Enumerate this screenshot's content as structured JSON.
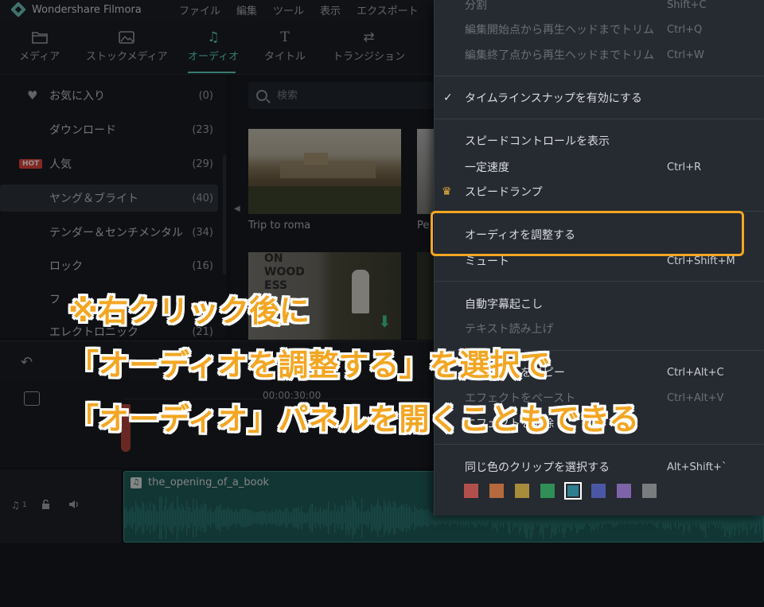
{
  "app": {
    "name": "Wondershare Filmora"
  },
  "menubar": [
    "ファイル",
    "編集",
    "ツール",
    "表示",
    "エクスポート"
  ],
  "tabs": [
    {
      "label": "メディア",
      "icon": "folder-icon"
    },
    {
      "label": "ストックメディア",
      "icon": "image-icon"
    },
    {
      "label": "オーディオ",
      "icon": "music-note-icon",
      "active": true
    },
    {
      "label": "タイトル",
      "icon": "text-icon"
    },
    {
      "label": "トランジション",
      "icon": "transition-icon"
    }
  ],
  "sidebar": {
    "items": [
      {
        "label": "お気に入り",
        "count": "(0)",
        "icon": "heart-icon"
      },
      {
        "label": "ダウンロード",
        "count": "(23)"
      },
      {
        "label": "人気",
        "count": "(29)",
        "badge": "HOT"
      },
      {
        "label": "ヤング＆ブライト",
        "count": "(40)",
        "selected": true
      },
      {
        "label": "テンダー＆センチメンタル",
        "count": "(34)"
      },
      {
        "label": "ロック",
        "count": "(16)"
      },
      {
        "label": "フ",
        "count": ""
      },
      {
        "label": "エレクトロニック",
        "count": "(21)"
      }
    ]
  },
  "search": {
    "placeholder": "検索"
  },
  "media": {
    "items": [
      {
        "caption": "Trip to roma"
      },
      {
        "caption": "Pe"
      }
    ],
    "thumb_text": [
      "ON",
      "WOOD",
      "ESS"
    ]
  },
  "timeline": {
    "time_marker": "00:00:30:00",
    "clip_name": "the_opening_of_a_book",
    "track_number": "1"
  },
  "context_menu": {
    "items": [
      {
        "label": "分割",
        "shortcut": "Shift+C",
        "disabled": true
      },
      {
        "label": "編集開始点から再生ヘッドまでトリム",
        "shortcut": "Ctrl+Q",
        "disabled": true
      },
      {
        "label": "編集終了点から再生ヘッドまでトリム",
        "shortcut": "Ctrl+W",
        "disabled": true
      },
      {
        "label": "タイムラインスナップを有効にする",
        "shortcut": "",
        "checked": true
      },
      {
        "label": "スピードコントロールを表示",
        "shortcut": ""
      },
      {
        "label": "一定速度",
        "shortcut": "Ctrl+R"
      },
      {
        "label": "スピードランプ",
        "shortcut": "",
        "icon": "crown-icon"
      },
      {
        "label": "オーディオを調整する",
        "shortcut": "",
        "highlighted": true
      },
      {
        "label": "ミュート",
        "shortcut": "Ctrl+Shift+M"
      },
      {
        "label": "自動字幕起こし",
        "shortcut": ""
      },
      {
        "label": "テキスト読み上げ",
        "shortcut": "",
        "disabled": true
      },
      {
        "label": "エフェクトをコピー",
        "shortcut": "Ctrl+Alt+C"
      },
      {
        "label": "エフェクトをペースト",
        "shortcut": "Ctrl+Alt+V",
        "disabled": true
      },
      {
        "label": "エフェクトを削除",
        "shortcut": ""
      },
      {
        "label": "同じ色のクリップを選択する",
        "shortcut": "Alt+Shift+`"
      }
    ],
    "swatch_colors": [
      "#b0504c",
      "#b46a3c",
      "#a78c3b",
      "#2f8f57",
      "#2f7d8f",
      "#4b57a4",
      "#7d63a9",
      "#7a7d80"
    ],
    "selected_swatch_index": 4
  },
  "annotation": {
    "line1": "※右クリック後に",
    "line2": "「オーディオを調整する」を選択で",
    "line3": "「オーディオ」パネルを開くこともできる",
    "color": "#f3a622"
  }
}
